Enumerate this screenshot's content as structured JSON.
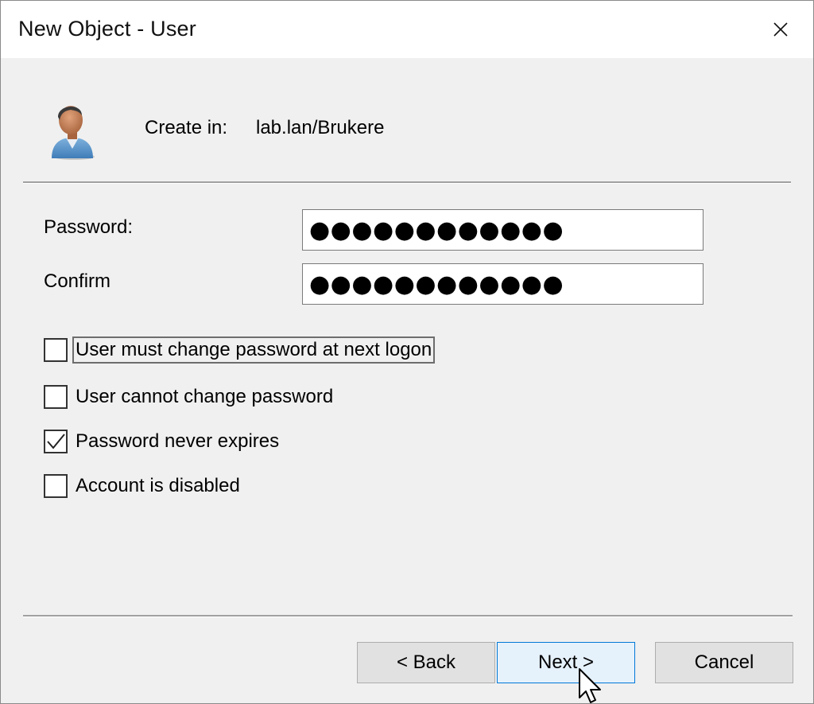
{
  "window": {
    "title": "New Object - User",
    "close_icon": "close-icon"
  },
  "header": {
    "icon": "user-icon",
    "create_in_label": "Create in:",
    "create_in_value": "lab.lan/Brukere"
  },
  "form": {
    "password_label": "Password:",
    "password_value": "●●●●●●●●●●●●",
    "confirm_label": "Confirm",
    "confirm_value": "●●●●●●●●●●●●"
  },
  "options": [
    {
      "label": "User must change password at next logon",
      "checked": false,
      "focused": true
    },
    {
      "label": "User cannot change password",
      "checked": false,
      "focused": false
    },
    {
      "label": "Password never expires",
      "checked": true,
      "focused": false
    },
    {
      "label": "Account is disabled",
      "checked": false,
      "focused": false
    }
  ],
  "buttons": {
    "back": "< Back",
    "next": "Next >",
    "cancel": "Cancel"
  },
  "colors": {
    "accent": "#0078d7",
    "titlebar": "#ffffff",
    "dialog_bg": "#f0f0f0"
  }
}
